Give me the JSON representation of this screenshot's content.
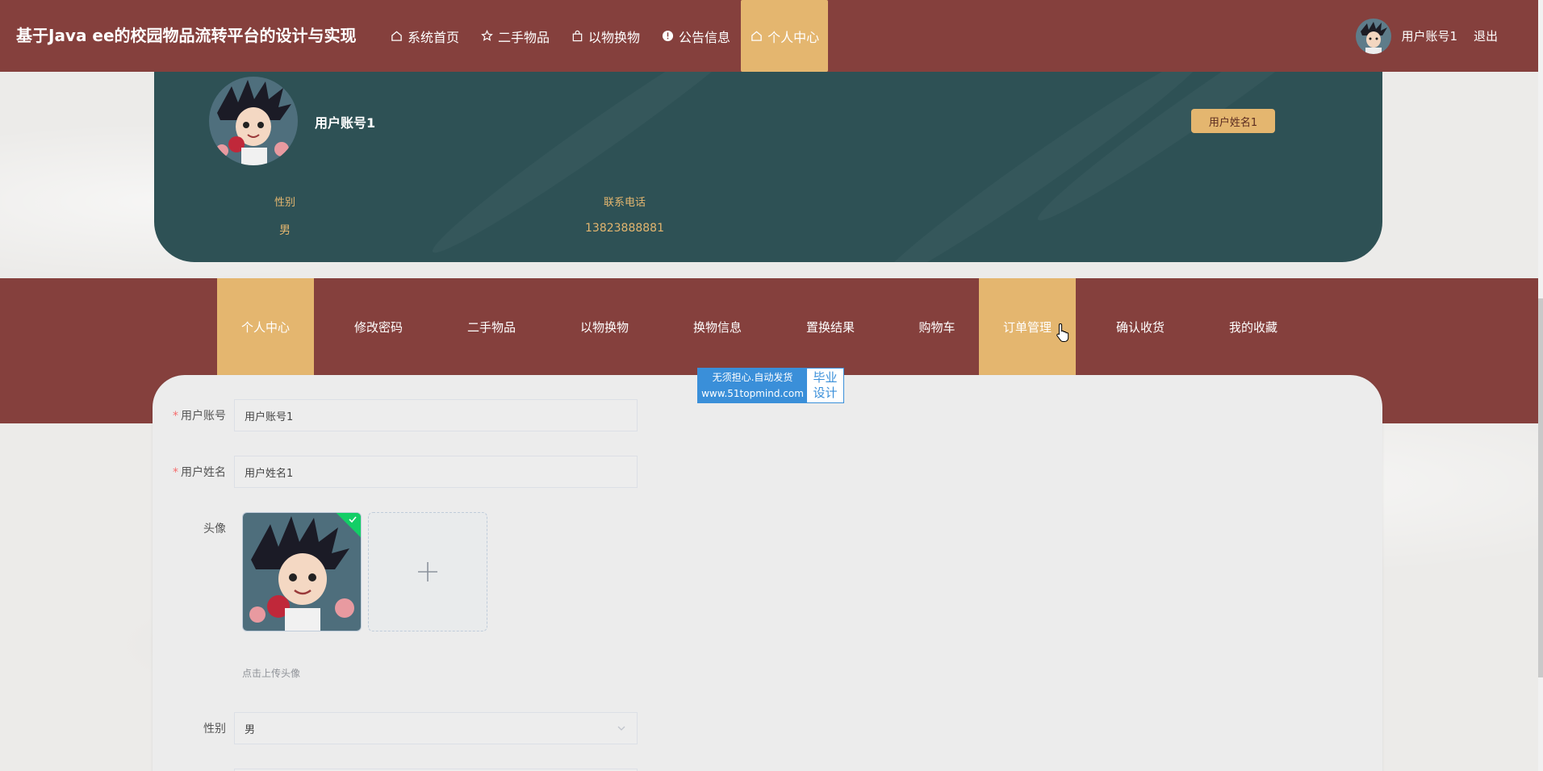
{
  "header": {
    "site_title": "基于Java ee的校园物品流转平台的设计与实现",
    "nav": [
      {
        "label": "系统首页",
        "icon": "home-icon"
      },
      {
        "label": "二手物品",
        "icon": "star-icon"
      },
      {
        "label": "以物换物",
        "icon": "bag-icon"
      },
      {
        "label": "公告信息",
        "icon": "alert-circle-icon"
      },
      {
        "label": "个人中心",
        "icon": "home-icon",
        "active": true
      }
    ],
    "username": "用户账号1",
    "logout_label": "退出"
  },
  "profile": {
    "account": "用户账号1",
    "name_badge": "用户姓名1",
    "gender_label": "性别",
    "gender_value": "男",
    "phone_label": "联系电话",
    "phone_value": "13823888881"
  },
  "menu": {
    "items": [
      {
        "label": "个人中心",
        "active": true
      },
      {
        "label": "修改密码"
      },
      {
        "label": "二手物品"
      },
      {
        "label": "以物换物"
      },
      {
        "label": "换物信息"
      },
      {
        "label": "置换结果"
      },
      {
        "label": "购物车"
      },
      {
        "label": "订单管理",
        "hover": true
      },
      {
        "label": "确认收货"
      },
      {
        "label": "我的收藏"
      }
    ]
  },
  "form": {
    "account_label": "用户账号",
    "account_value": "用户账号1",
    "name_label": "用户姓名",
    "name_value": "用户姓名1",
    "avatar_label": "头像",
    "upload_tip": "点击上传头像",
    "gender_label": "性别",
    "gender_value": "男"
  },
  "watermark": {
    "line1": "无须担心.自动发货",
    "line2": "www.51topmind.com",
    "right1": "毕业",
    "right2": "设计"
  },
  "colors": {
    "brand": "#85403d",
    "accent": "#e4b66f",
    "profile_bg": "#2e5155"
  }
}
